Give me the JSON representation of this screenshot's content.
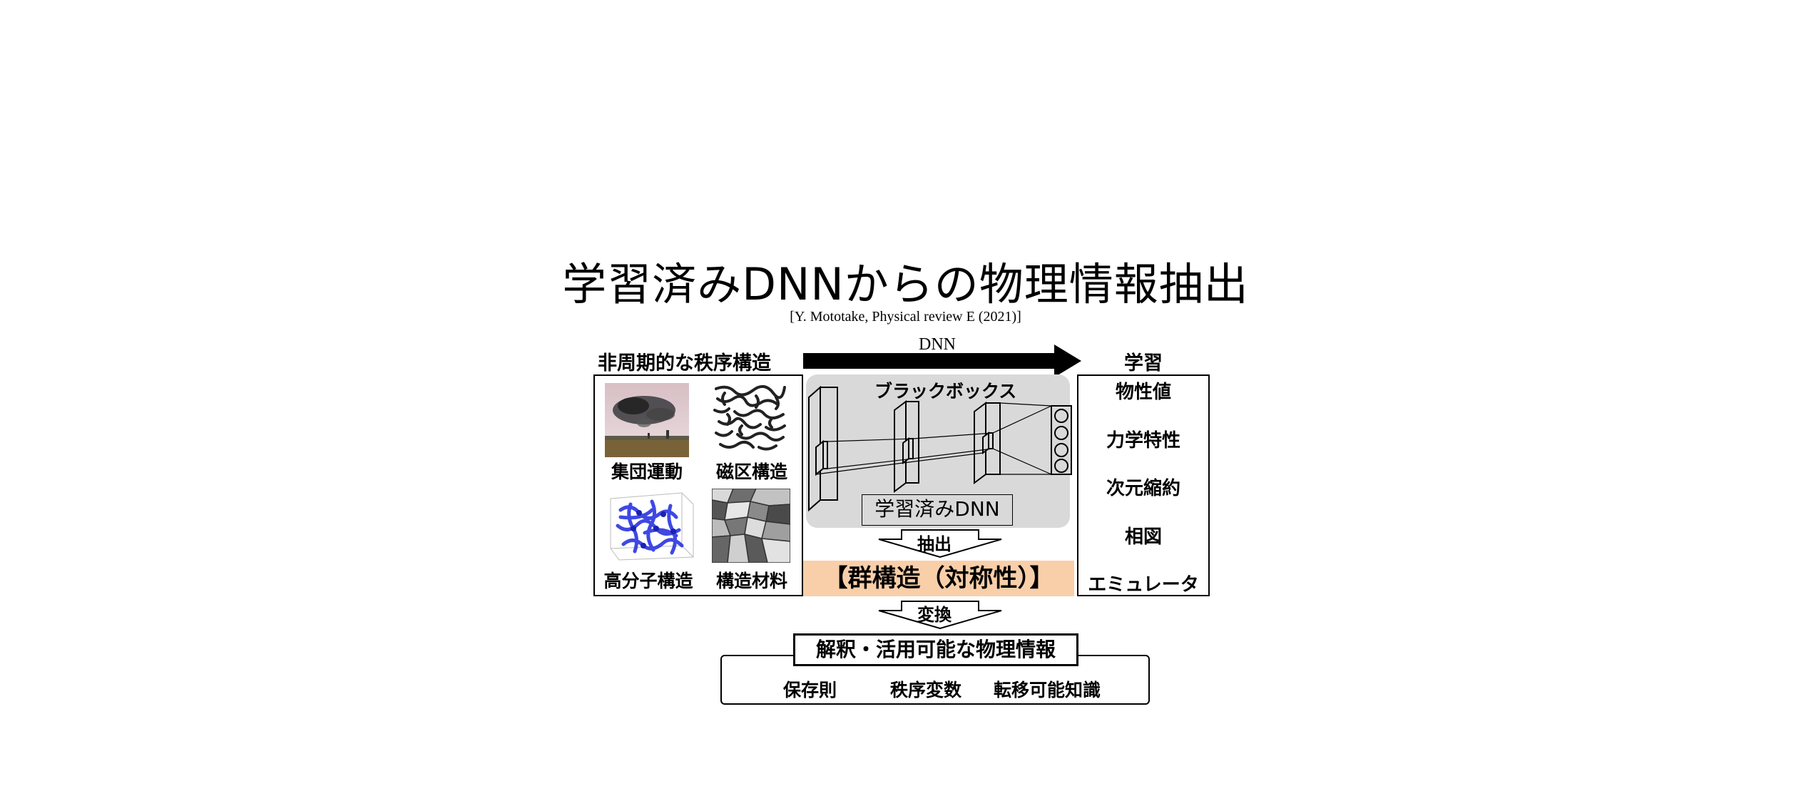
{
  "title": "学習済みDNNからの物理情報抽出",
  "citation": "[Y. Mototake, Physical review E (2021)]",
  "input": {
    "heading": "非周期的な秩序構造",
    "examples": [
      {
        "label": "集団運動",
        "icon": "bird-flock-photo"
      },
      {
        "label": "磁区構造",
        "icon": "maze-pattern"
      },
      {
        "label": "高分子構造",
        "icon": "polymer-network-3d"
      },
      {
        "label": "構造材料",
        "icon": "grain-microstructure"
      }
    ]
  },
  "dnn": {
    "arrow_label": "DNN",
    "blackbox_label": "ブラックボックス",
    "trained_label": "学習済みDNN"
  },
  "learning": {
    "heading": "学習",
    "items": [
      "物性値",
      "力学特性",
      "次元縮約",
      "相図",
      "エミュレータ"
    ]
  },
  "extract_label": "抽出",
  "group_structure": "【群構造（対称性）】",
  "transform_label": "変換",
  "output": {
    "heading": "解釈・活用可能な物理情報",
    "items": [
      "保存則",
      "秩序変数",
      "転移可能知識"
    ]
  },
  "colors": {
    "group_band": "#f9cfa9",
    "blackbox_bg": "#d9d9d9",
    "polymer_blue": "#2b35e0"
  }
}
